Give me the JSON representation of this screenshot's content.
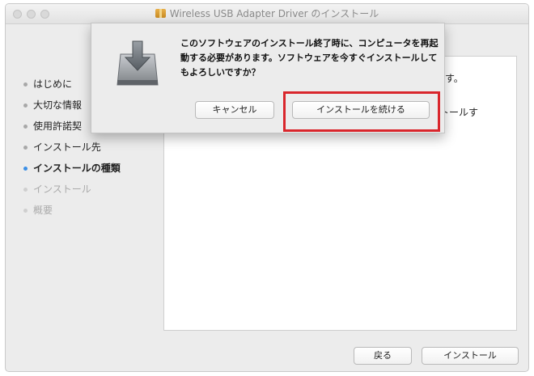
{
  "window": {
    "title": "Wireless USB Adapter Driver のインストール"
  },
  "sidebar": {
    "items": [
      {
        "label": "はじめに",
        "state": "done"
      },
      {
        "label": "大切な情報",
        "state": "done"
      },
      {
        "label": "使用許諾契",
        "state": "done"
      },
      {
        "label": "インストール先",
        "state": "done"
      },
      {
        "label": "インストールの種類",
        "state": "active"
      },
      {
        "label": "インストール",
        "state": "future"
      },
      {
        "label": "概要",
        "state": "future"
      }
    ]
  },
  "content": {
    "text_1": "す。",
    "text_2": "トールす"
  },
  "footer": {
    "back_label": "戻る",
    "install_label": "インストール"
  },
  "dialog": {
    "message": "このソフトウェアのインストール終了時に、コンピュータを再起動する必要があります。ソフトウェアを今すぐインストールしてもよろしいですか？",
    "cancel_label": "キャンセル",
    "continue_label": "インストールを続ける"
  },
  "colors": {
    "highlight": "#d9262c",
    "active_step": "#3b8fe6"
  }
}
